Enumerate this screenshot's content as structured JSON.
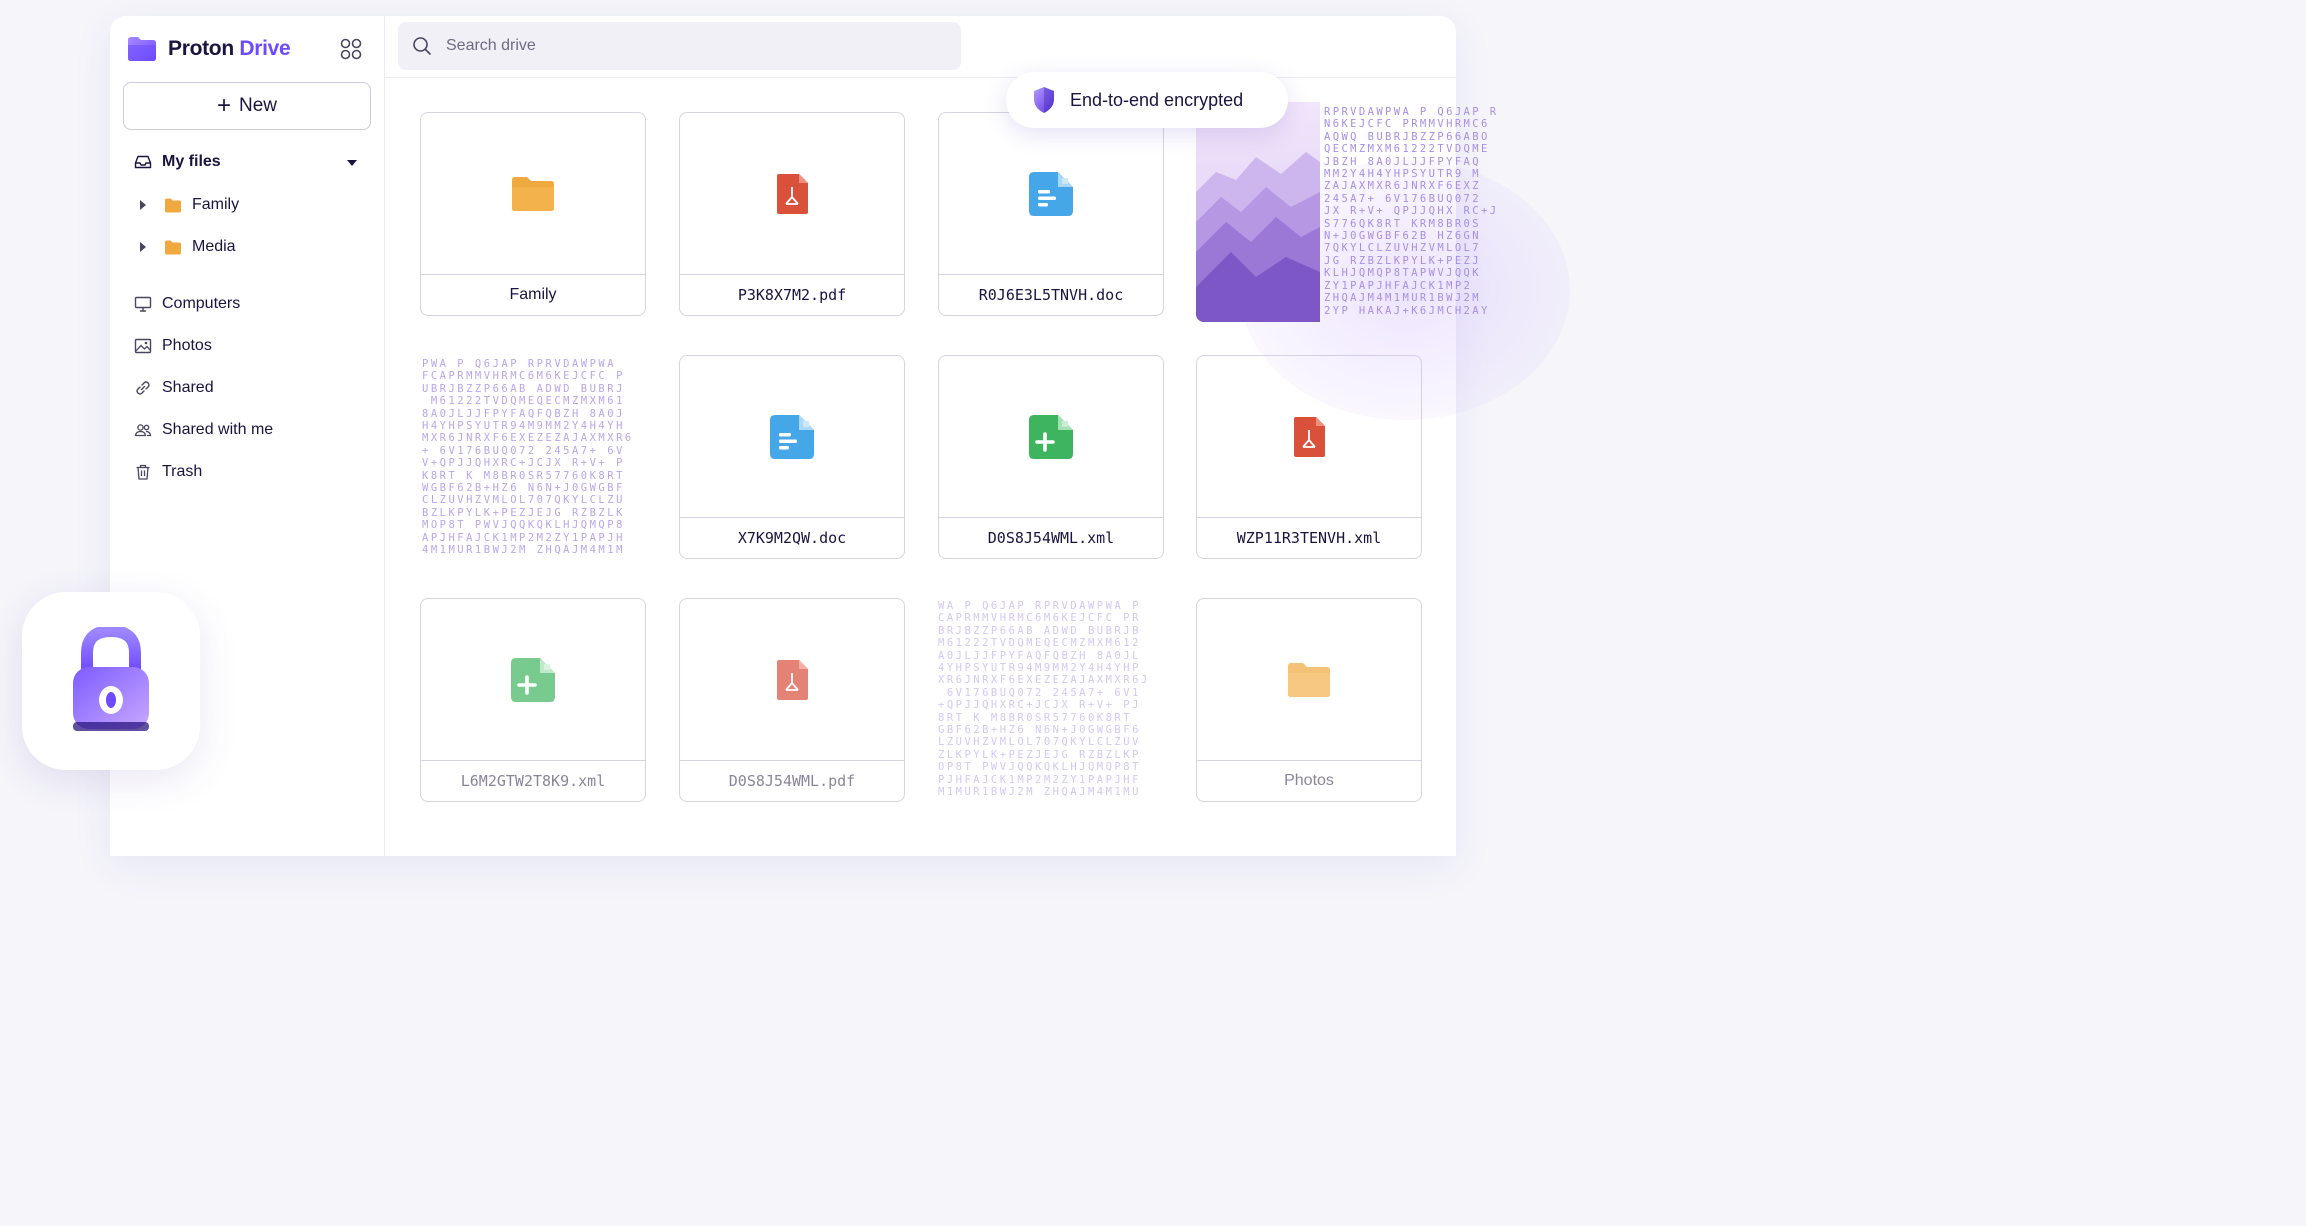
{
  "app": {
    "brand_first": "Proton",
    "brand_second": "Drive"
  },
  "sidebar": {
    "new_label": "New",
    "my_files_label": "My files",
    "tree": [
      {
        "label": "Family"
      },
      {
        "label": "Media"
      }
    ],
    "nav": [
      {
        "label": "Computers",
        "icon": "monitor-icon"
      },
      {
        "label": "Photos",
        "icon": "image-icon"
      },
      {
        "label": "Shared",
        "icon": "link-icon"
      },
      {
        "label": "Shared with me",
        "icon": "users-icon"
      },
      {
        "label": "Trash",
        "icon": "trash-icon"
      }
    ]
  },
  "search": {
    "placeholder": "Search drive"
  },
  "badge": {
    "label": "End-to-end encrypted"
  },
  "files": [
    {
      "name": "Family",
      "type": "folder"
    },
    {
      "name": "P3K8X7M2.pdf",
      "type": "pdf"
    },
    {
      "name": "R0J6E3L5TNVH.doc",
      "type": "doc"
    },
    {
      "name": "X7K9M2QW.doc",
      "type": "doc"
    },
    {
      "name": "D0S8J54WML.xml",
      "type": "sheet"
    },
    {
      "name": "WZP11R3TENVH.xml",
      "type": "pdf"
    },
    {
      "name": "L6M2GTW2T8K9.xml",
      "type": "sheet"
    },
    {
      "name": "D0S8J54WML.pdf",
      "type": "pdf"
    },
    {
      "name": "Photos",
      "type": "folder"
    }
  ],
  "colors": {
    "accent": "#6d4aff",
    "folder": "#f0a93e",
    "pdf": "#d9503b",
    "doc": "#46a7e8",
    "sheet": "#3fb45f"
  }
}
